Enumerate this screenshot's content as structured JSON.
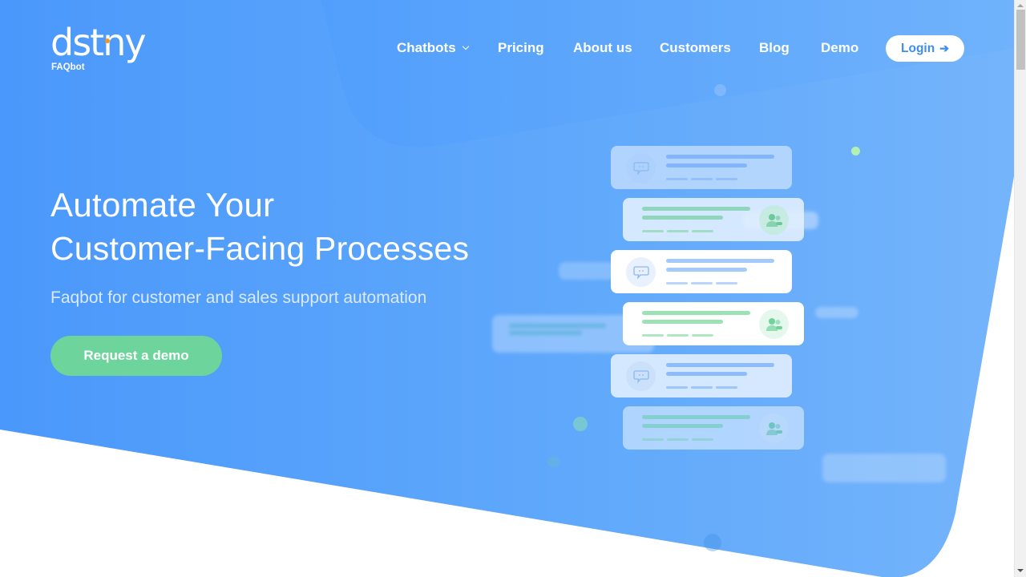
{
  "brand": {
    "logo_text": "dstny",
    "product": "FAQbot",
    "logo_dot_color": "#f7941d"
  },
  "nav": {
    "items": [
      {
        "label": "Chatbots",
        "has_dropdown": true
      },
      {
        "label": "Pricing"
      },
      {
        "label": "About us"
      },
      {
        "label": "Customers"
      },
      {
        "label": "Blog"
      },
      {
        "label": "Demo"
      }
    ],
    "login_label": "Login",
    "login_icon": "arrow-right-icon"
  },
  "hero": {
    "title_line1": "Automate Your",
    "title_line2": "Customer-Facing Processes",
    "subtitle": "Faqbot for customer and sales support automation",
    "cta_label": "Request a demo"
  },
  "illustration": {
    "cards": [
      {
        "type": "bot",
        "icon": "chat-bubble-icon"
      },
      {
        "type": "user",
        "icon": "users-icon"
      },
      {
        "type": "bot",
        "icon": "chat-bubble-icon"
      },
      {
        "type": "user",
        "icon": "users-icon"
      },
      {
        "type": "bot",
        "icon": "chat-bubble-icon"
      },
      {
        "type": "user",
        "icon": "users-icon"
      }
    ]
  },
  "colors": {
    "hero_blue": "#4f9dfb",
    "cta_green": "#6dd59c",
    "login_text": "#3d8ef0"
  }
}
